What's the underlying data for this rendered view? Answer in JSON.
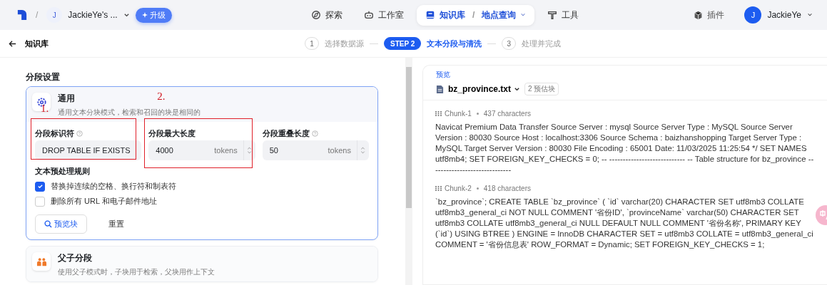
{
  "topbar": {
    "separator": "/",
    "workspace_avatar": "J",
    "workspace": "JackieYe's ...",
    "upgrade": "升级",
    "nav": [
      {
        "kind": "explore",
        "label": "探索",
        "selected": false
      },
      {
        "kind": "studio",
        "label": "工作室",
        "selected": false
      },
      {
        "kind": "knowledge",
        "label": "知识库",
        "sub_separator": "/",
        "sub": "地点查询",
        "selected": true
      },
      {
        "kind": "tools",
        "label": "工具",
        "selected": false
      }
    ],
    "plugins": "插件",
    "user": {
      "avatar": "J",
      "name": "JackieYe"
    }
  },
  "header": {
    "back_label": "知识库",
    "steps": [
      {
        "number": "1",
        "label": "选择数据源",
        "selected": false
      },
      {
        "number": "STEP 2",
        "label": "文本分段与清洗",
        "selected": true
      },
      {
        "number": "3",
        "label": "处理并完成",
        "selected": false
      }
    ]
  },
  "settings": {
    "title": "分段设置",
    "modes": [
      {
        "kind": "general",
        "title": "通用",
        "description": "通用文本分块模式，检索和召回的块是相同的",
        "selected": true
      },
      {
        "kind": "parent_child",
        "title": "父子分段",
        "description": "使用父子模式时，子块用于检索，父块用作上下文",
        "selected": false
      }
    ],
    "fields": [
      {
        "label": "分段标识符",
        "help": true,
        "value": "DROP TABLE IF EXISTS",
        "annotation": "1."
      },
      {
        "label": "分段最大长度",
        "help": false,
        "value": "4000",
        "unit": "tokens",
        "annotation": "2."
      },
      {
        "label": "分段重叠长度",
        "help": true,
        "value": "50",
        "unit": "tokens"
      }
    ],
    "rules_title": "文本预处理规则",
    "rules": [
      {
        "label": "替换掉连续的空格、换行符和制表符",
        "checked": true
      },
      {
        "label": "删除所有 URL 和电子邮件地址",
        "checked": false
      }
    ],
    "preview_button": "预览块",
    "reset_button": "重置"
  },
  "preview": {
    "label": "预览",
    "file": "bz_province.txt",
    "badge": "2 预估块",
    "chunks": [
      {
        "name": "Chunk-1",
        "count": "437 characters",
        "text": "Navicat Premium Data Transfer Source Server : mysql Source Server Type : MySQL Source Server Version : 80030 Source Host : localhost:3306 Source Schema : baizhanshopping Target Server Type : MySQL Target Server Version : 80030 File Encoding : 65001 Date: 11/03/2025 11:25:54 */ SET NAMES utf8mb4; SET FOREIGN_KEY_CHECKS = 0; -- ---------------------------- -- Table structure for bz_province -- ----------------------------"
      },
      {
        "name": "Chunk-2",
        "count": "418 characters",
        "text": "`bz_province`; CREATE TABLE `bz_province` ( `id` varchar(20) CHARACTER SET utf8mb3 COLLATE utf8mb3_general_ci NOT NULL COMMENT '省份ID', `provinceName` varchar(50) CHARACTER SET utf8mb3 COLLATE utf8mb3_general_ci NULL DEFAULT NULL COMMENT '省份名称', PRIMARY KEY (`id`) USING BTREE ) ENGINE = InnoDB CHARACTER SET = utf8mb3 COLLATE = utf8mb3_general_ci COMMENT = '省份信息表' ROW_FORMAT = Dynamic; SET FOREIGN_KEY_CHECKS = 1;"
      }
    ]
  }
}
